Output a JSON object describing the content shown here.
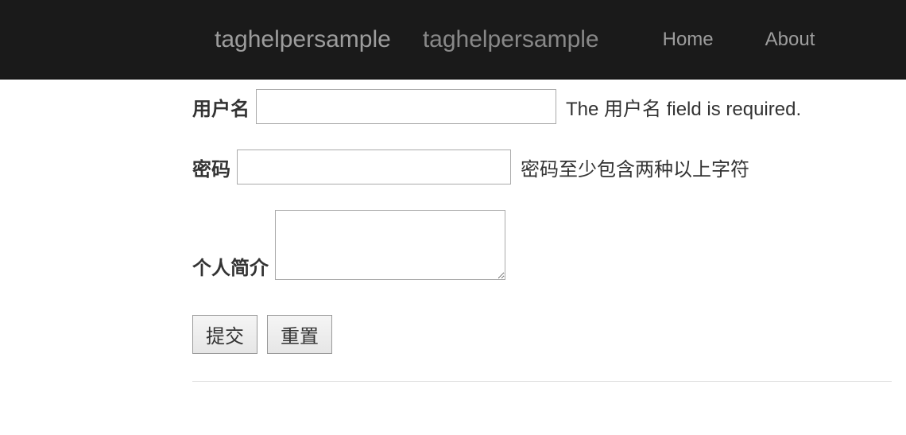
{
  "navbar": {
    "brand1": "taghelpersample",
    "brand2": "taghelpersample",
    "links": [
      {
        "label": "Home"
      },
      {
        "label": "About"
      }
    ]
  },
  "form": {
    "username": {
      "label": "用户名",
      "value": "",
      "validation": "The 用户名 field is required."
    },
    "password": {
      "label": "密码",
      "value": "",
      "validation": "密码至少包含两种以上字符"
    },
    "bio": {
      "label": "个人简介",
      "value": ""
    },
    "buttons": {
      "submit": "提交",
      "reset": "重置"
    }
  }
}
